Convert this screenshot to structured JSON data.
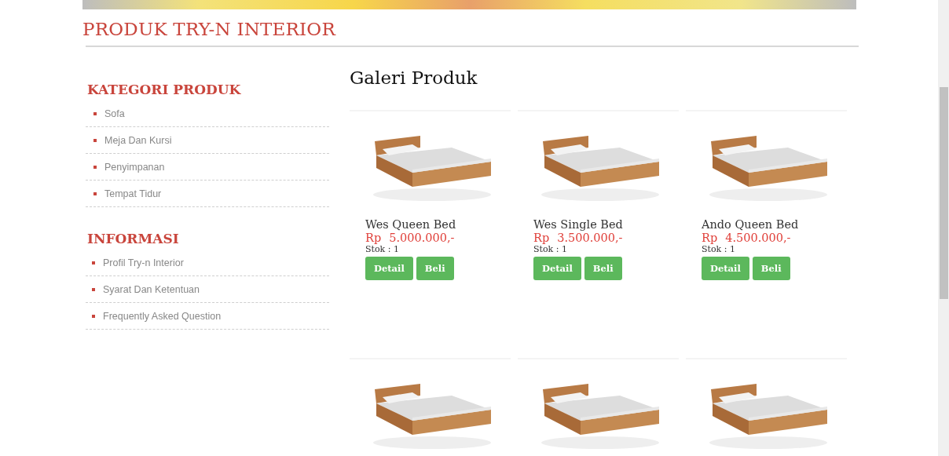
{
  "header": {
    "title": "PRODUK TRY-N INTERIOR"
  },
  "sidebar": [
    {
      "heading": "KATEGORI PRODUK",
      "items": [
        "Sofa",
        "Meja Dan Kursi",
        "Penyimpanan",
        "Tempat Tidur"
      ]
    },
    {
      "heading": "INFORMASI",
      "items": [
        "Profil Try-n Interior",
        "Syarat Dan Ketentuan",
        "Frequently Asked Question"
      ]
    }
  ],
  "gallery": {
    "title": "Galeri Produk",
    "products": [
      {
        "kind": "full",
        "name": "Wes Queen Bed",
        "currency": "Rp",
        "price": "5.000.000,-",
        "stock": "Stok : 1",
        "buttons": [
          "Detail",
          "Beli"
        ]
      },
      {
        "kind": "full",
        "name": "Wes Single Bed",
        "currency": "Rp",
        "price": "3.500.000,-",
        "stock": "Stok : 1",
        "buttons": [
          "Detail",
          "Beli"
        ]
      },
      {
        "kind": "full",
        "name": "Ando Queen Bed",
        "currency": "Rp",
        "price": "4.500.000,-",
        "stock": "Stok : 1",
        "buttons": [
          "Detail",
          "Beli"
        ]
      },
      {
        "kind": "image"
      },
      {
        "kind": "image"
      },
      {
        "kind": "image"
      }
    ]
  }
}
